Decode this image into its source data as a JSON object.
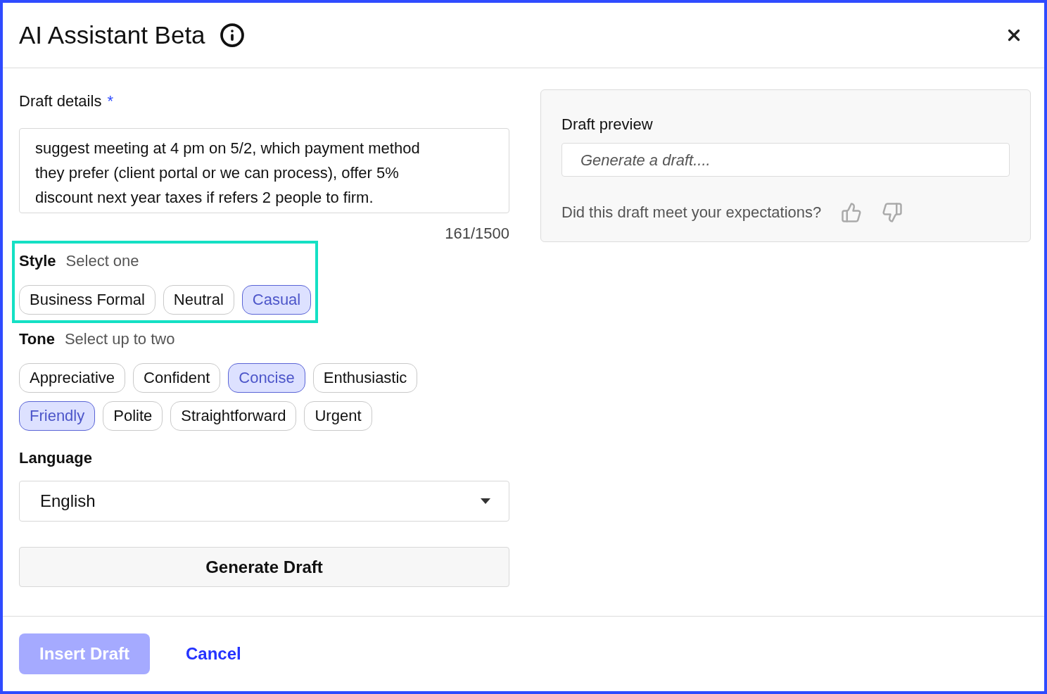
{
  "dialog": {
    "title": "AI Assistant Beta"
  },
  "draft_details": {
    "label": "Draft details",
    "required_mark": "*",
    "value": "suggest meeting at 4 pm on 5/2, which payment method they prefer (client portal or we can process), offer 5% discount next year taxes if refers 2 people to firm.",
    "counter": "161/1500"
  },
  "style": {
    "label": "Style",
    "hint": "Select one",
    "highlighted": true,
    "options": [
      {
        "label": "Business Formal",
        "selected": false
      },
      {
        "label": "Neutral",
        "selected": false
      },
      {
        "label": "Casual",
        "selected": true
      }
    ]
  },
  "tone": {
    "label": "Tone",
    "hint": "Select up to two",
    "highlighted": false,
    "options": [
      {
        "label": "Appreciative",
        "selected": false
      },
      {
        "label": "Confident",
        "selected": false
      },
      {
        "label": "Concise",
        "selected": true
      },
      {
        "label": "Enthusiastic",
        "selected": false
      },
      {
        "label": "Friendly",
        "selected": true
      },
      {
        "label": "Polite",
        "selected": false
      },
      {
        "label": "Straightforward",
        "selected": false
      },
      {
        "label": "Urgent",
        "selected": false
      }
    ]
  },
  "language": {
    "label": "Language",
    "value": "English"
  },
  "generate_button": "Generate Draft",
  "preview": {
    "title": "Draft preview",
    "placeholder": "Generate a draft....",
    "feedback_question": "Did this draft meet your expectations?"
  },
  "footer": {
    "insert_button": {
      "label": "Insert Draft",
      "disabled": true
    },
    "cancel_link": "Cancel"
  }
}
